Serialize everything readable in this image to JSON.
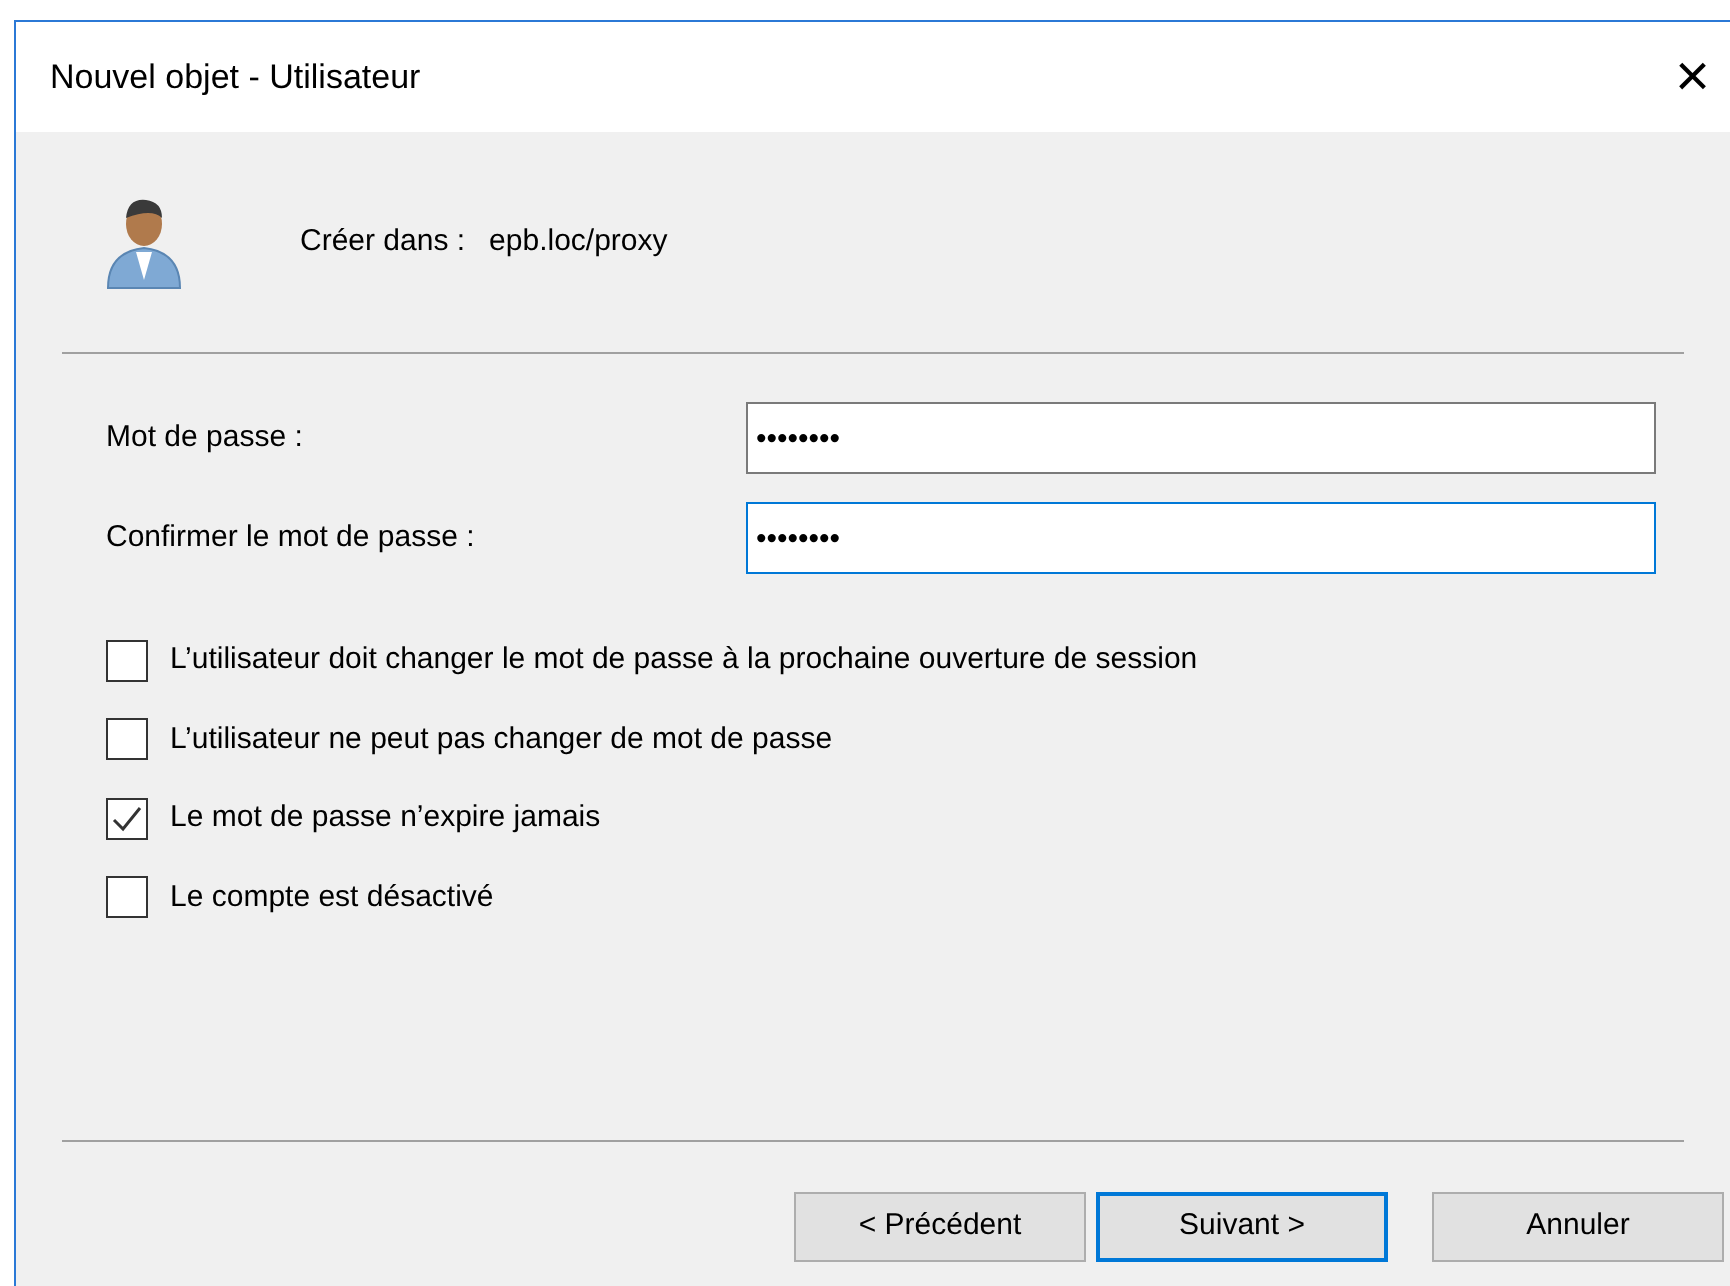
{
  "window": {
    "title": "Nouvel objet - Utilisateur",
    "close": "×"
  },
  "header": {
    "label": "Créer dans :",
    "value": "epb.loc/proxy"
  },
  "fields": [
    {
      "label": "Mot de passe :",
      "value": "••••••••",
      "focused": false
    },
    {
      "label": "Confirmer le mot de passe :",
      "value": "••••••••",
      "focused": true
    }
  ],
  "options": [
    {
      "label": "L’utilisateur doit changer le mot de passe à la prochaine ouverture de session",
      "checked": false
    },
    {
      "label": "L’utilisateur ne peut pas changer de mot de passe",
      "checked": false
    },
    {
      "label": "Le mot de passe n’expire jamais",
      "checked": true
    },
    {
      "label": "Le compte est désactivé",
      "checked": false
    }
  ],
  "buttons": [
    {
      "label": "< Précédent",
      "default": false
    },
    {
      "label": "Suivant >",
      "default": true
    },
    {
      "label": "Annuler",
      "default": false
    }
  ]
}
